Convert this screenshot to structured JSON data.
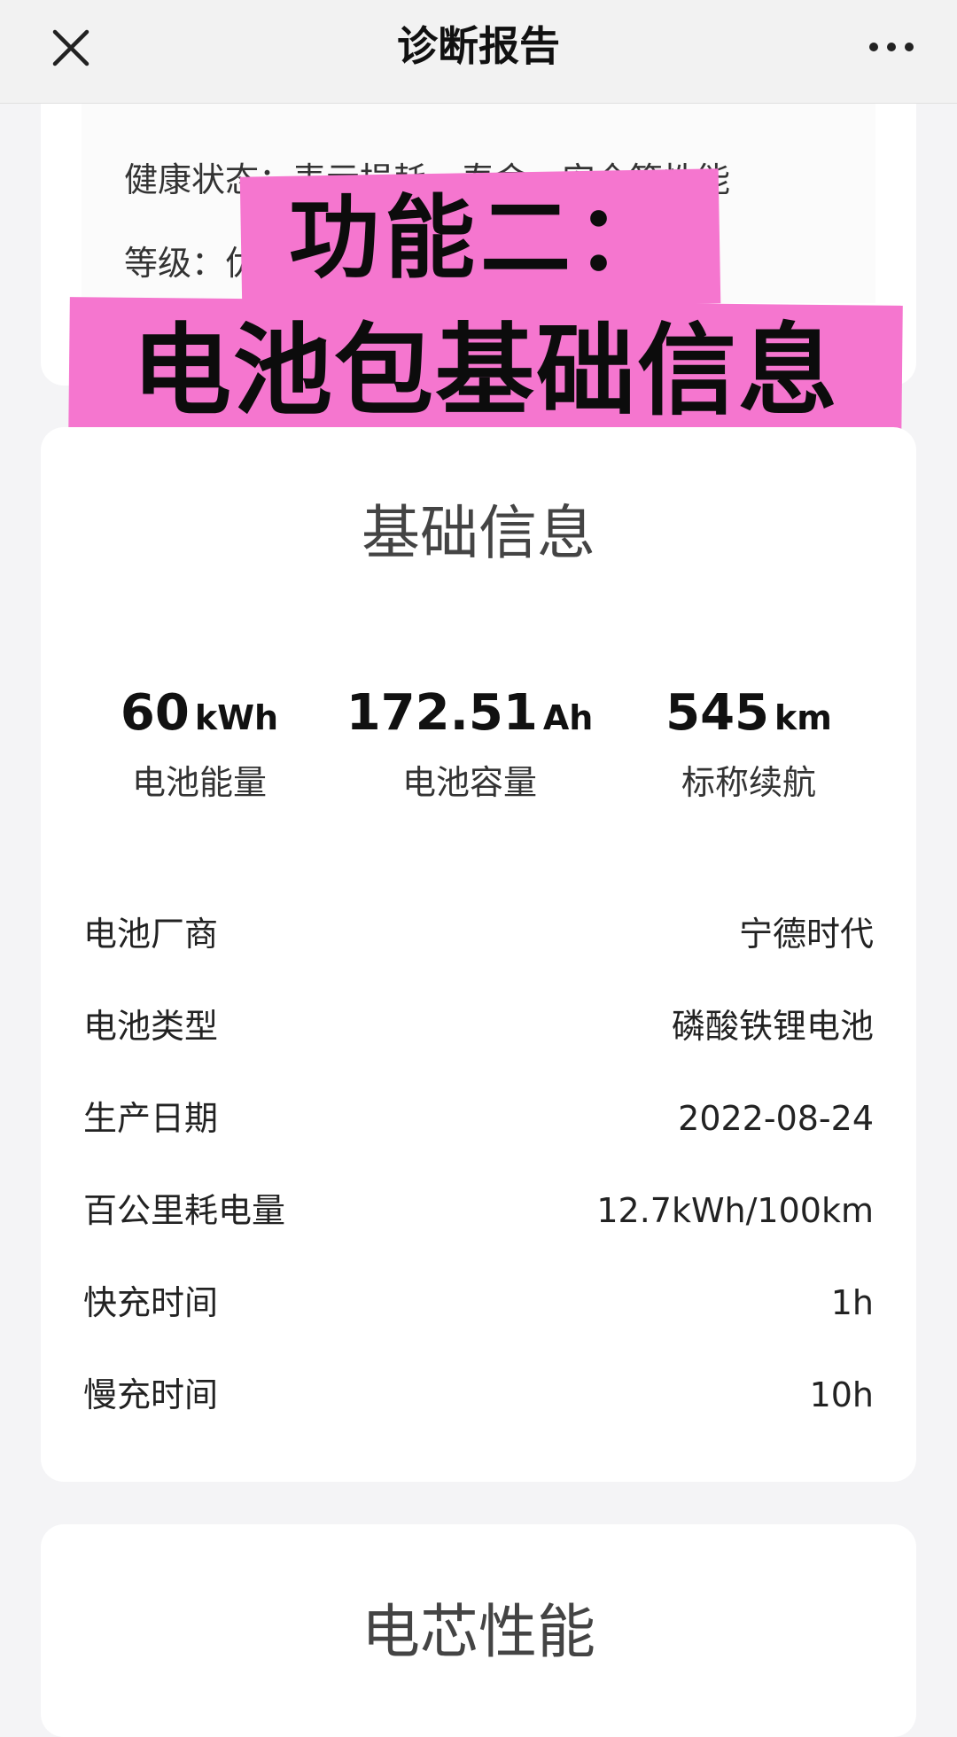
{
  "header": {
    "title": "诊断报告",
    "close_icon": "close-icon",
    "more_icon": "more-icon"
  },
  "health_card": {
    "status_line": "健康状态：表示损耗、寿命、安全等性能",
    "grade_line": "等级：优                              差"
  },
  "banner": {
    "line1": "功能二：",
    "line2": "电池包基础信息",
    "color": "#f576cf"
  },
  "basic_info": {
    "title": "基础信息",
    "metrics": [
      {
        "value": "60",
        "unit": "kWh",
        "label": "电池能量"
      },
      {
        "value": "172.51",
        "unit": "Ah",
        "label": "电池容量"
      },
      {
        "value": "545",
        "unit": "km",
        "label": "标称续航"
      }
    ],
    "rows": [
      {
        "key": "电池厂商",
        "value": "宁德时代"
      },
      {
        "key": "电池类型",
        "value": "磷酸铁锂电池"
      },
      {
        "key": "生产日期",
        "value": "2022-08-24"
      },
      {
        "key": "百公里耗电量",
        "value": "12.7kWh/100km"
      },
      {
        "key": "快充时间",
        "value": "1h"
      },
      {
        "key": "慢充时间",
        "value": "10h"
      }
    ]
  },
  "cell_performance": {
    "title": "电芯性能"
  }
}
